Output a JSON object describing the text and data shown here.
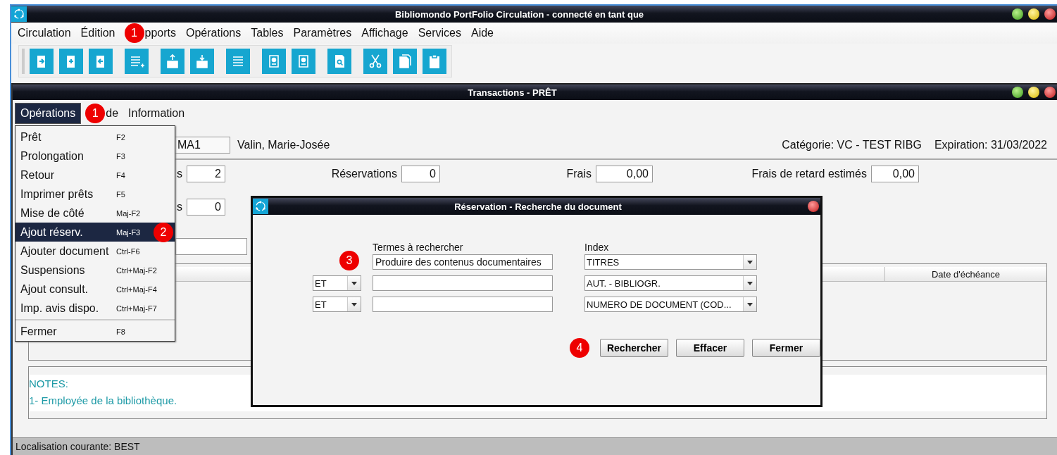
{
  "window": {
    "title": "Bibliomondo PortFolio Circulation - connecté en tant que"
  },
  "menubar": [
    {
      "label": "Circulation"
    },
    {
      "label": "Édition"
    },
    {
      "label": "pports",
      "callout": "1"
    },
    {
      "label": "Opérations"
    },
    {
      "label": "Tables"
    },
    {
      "label": "Paramètres"
    },
    {
      "label": "Affichage"
    },
    {
      "label": "Services"
    },
    {
      "label": "Aide"
    }
  ],
  "transactions_window": {
    "title": "Transactions - PRÊT",
    "menubar": [
      {
        "label": "Opérations",
        "selected": true
      },
      {
        "label": "de",
        "selected": false,
        "callout": "1"
      },
      {
        "label": "Information",
        "selected": false
      }
    ],
    "menu": [
      [
        {
          "label": "Prêt",
          "shortcut": "F2",
          "selected": false
        },
        {
          "label": "Prolongation",
          "shortcut": "F3",
          "selected": false
        },
        {
          "label": "Retour",
          "shortcut": "F4",
          "selected": false
        },
        {
          "label": "Imprimer prêts",
          "shortcut": "F5",
          "selected": false
        },
        {
          "label": "Mise de côté",
          "shortcut": "Maj-F2",
          "selected": false
        },
        {
          "label": "Ajout réserv.",
          "shortcut": "Maj-F3",
          "selected": true,
          "callout": "2"
        },
        {
          "label": "Ajouter document",
          "shortcut": "Ctrl-F6",
          "selected": false
        },
        {
          "label": "Suspensions",
          "shortcut": "Ctrl+Maj-F2",
          "selected": false
        },
        {
          "label": "Ajout consult.",
          "shortcut": "Ctrl+Maj-F4",
          "selected": false
        },
        {
          "label": "Imp. avis dispo.",
          "shortcut": "Ctrl+Maj-F7",
          "selected": false
        }
      ],
      [
        {
          "label": "Fermer",
          "shortcut": "F8",
          "selected": false
        }
      ]
    ],
    "patron": {
      "value": "MA1",
      "name": "Valin, Marie-Josée",
      "category": "Catégorie: VC - TEST RIBG",
      "expiration": "Expiration: 31/03/2022"
    },
    "stats": [
      {
        "label": "s",
        "value": "2"
      },
      {
        "label": "Réservations",
        "value": "0"
      },
      {
        "label": "Frais",
        "value": "0,00"
      },
      {
        "label": "Frais de retard estimés",
        "value": "0,00"
      }
    ],
    "stats_row_2": [
      {
        "label": "s",
        "value": "0"
      }
    ],
    "table": {
      "columns": [
        "Date d'échéance"
      ]
    },
    "notes": [
      "NOTES:",
      "1- Employée de la bibliothèque."
    ],
    "status_bar": "Localisation courante: BEST"
  },
  "dialog": {
    "title": "Réservation - Recherche du document",
    "terms_label": "Termes à rechercher",
    "index_label": "Index",
    "rows": [
      {
        "term": "Produire des contenus documentaires",
        "index": "TITRES",
        "callout": "3"
      },
      {
        "operator": "ET",
        "index": "AUT. - BIBLIOGR."
      },
      {
        "operator": "ET",
        "index": "NUMERO DE DOCUMENT (COD..."
      }
    ],
    "buttons": [
      {
        "label": "Rechercher",
        "callout": "4"
      },
      {
        "label": "Effacer"
      },
      {
        "label": "Fermer"
      }
    ]
  }
}
